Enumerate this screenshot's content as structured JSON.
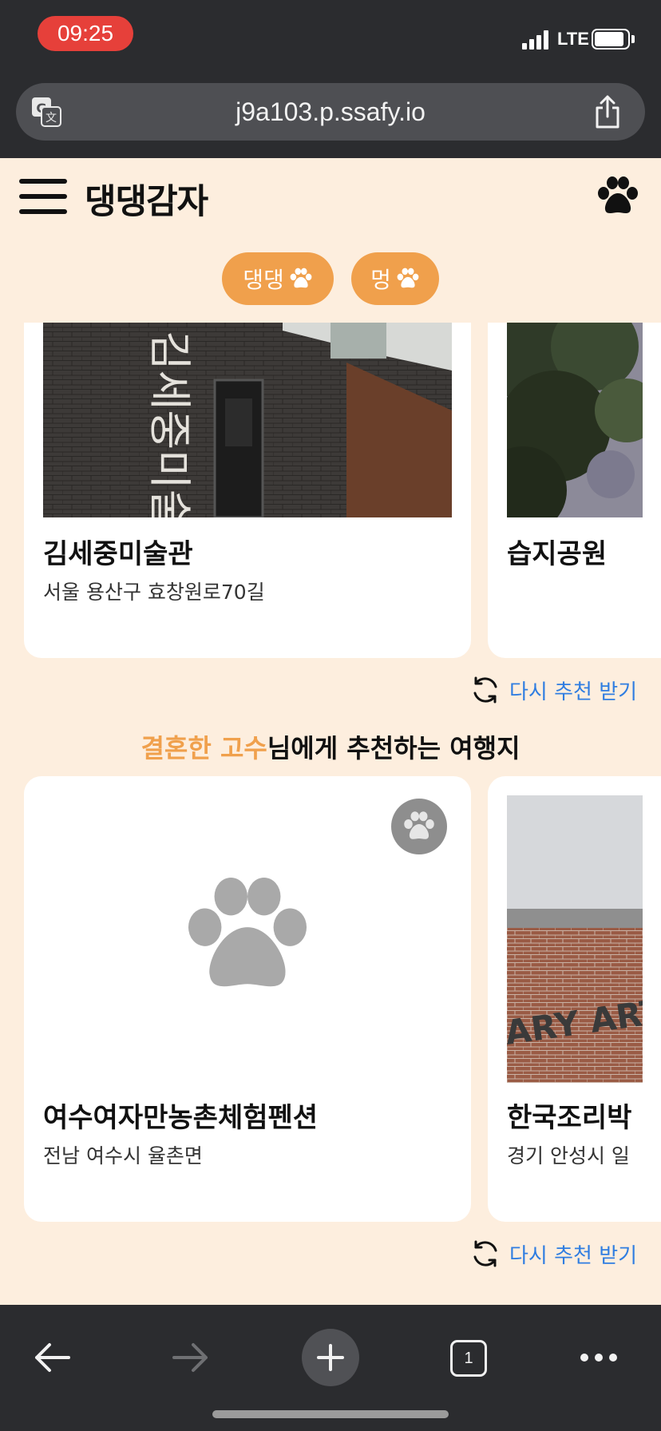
{
  "status_bar": {
    "time": "09:25",
    "network": "LTE"
  },
  "browser": {
    "url": "j9a103.p.ssafy.io",
    "tab_count": "1"
  },
  "app": {
    "title": "댕댕감자"
  },
  "chips": [
    {
      "label": "댕댕"
    },
    {
      "label": "멍"
    }
  ],
  "top_row": {
    "cards": [
      {
        "title": "김세중미술관",
        "address": "서울 용산구 효창원로70길"
      },
      {
        "title": "습지공원"
      }
    ],
    "refresh_label": "다시 추천 받기"
  },
  "section": {
    "highlight": "결혼한 고수",
    "rest": "님에게 추천하는 여행지"
  },
  "bottom_row": {
    "cards": [
      {
        "title": "여수여자만농촌체험펜션",
        "address": "전남 여수시 율촌면"
      },
      {
        "title": "한국조리박",
        "address": "경기 안성시 일"
      }
    ],
    "refresh_label": "다시 추천 받기"
  },
  "image_text": {
    "museum_sign": "김세중미술관",
    "gallery_sign": "ARY ART"
  },
  "colors": {
    "accent": "#f0a04c",
    "background": "#fdeede",
    "link": "#2f7de1",
    "status_time": "#e6403a"
  }
}
